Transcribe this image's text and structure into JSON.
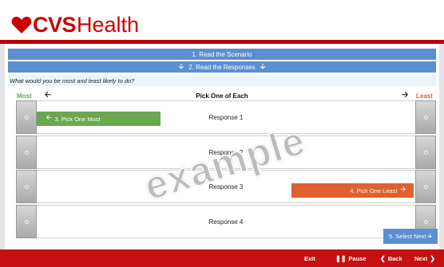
{
  "brand": {
    "name_bold": "CVS",
    "name_light": "Health",
    "color": "#cc0000"
  },
  "scenario_bar": {
    "label": "1. Read the Scenario"
  },
  "responses_bar": {
    "label": "2. Read the Responses",
    "icon": "arrow-down-icon"
  },
  "question": "What would you be most and least likely to do?",
  "columns": {
    "most": "Most",
    "title": "Pick One of Each",
    "least": "Least"
  },
  "responses": [
    {
      "label": "Response 1"
    },
    {
      "label": "Response 2"
    },
    {
      "label": "Response 3"
    },
    {
      "label": "Response 4"
    }
  ],
  "hints": {
    "most": "3. Pick One Most",
    "least": "4. Pick One Least",
    "next": "5. Select Next"
  },
  "watermark": "example",
  "footer": {
    "exit": "Exit",
    "pause": "Pause",
    "back": "Back",
    "next": "Next"
  },
  "colors": {
    "blue": "#5b8fd0",
    "green": "#6aa84f",
    "orange": "#e06030",
    "footer_red": "#c41010"
  }
}
